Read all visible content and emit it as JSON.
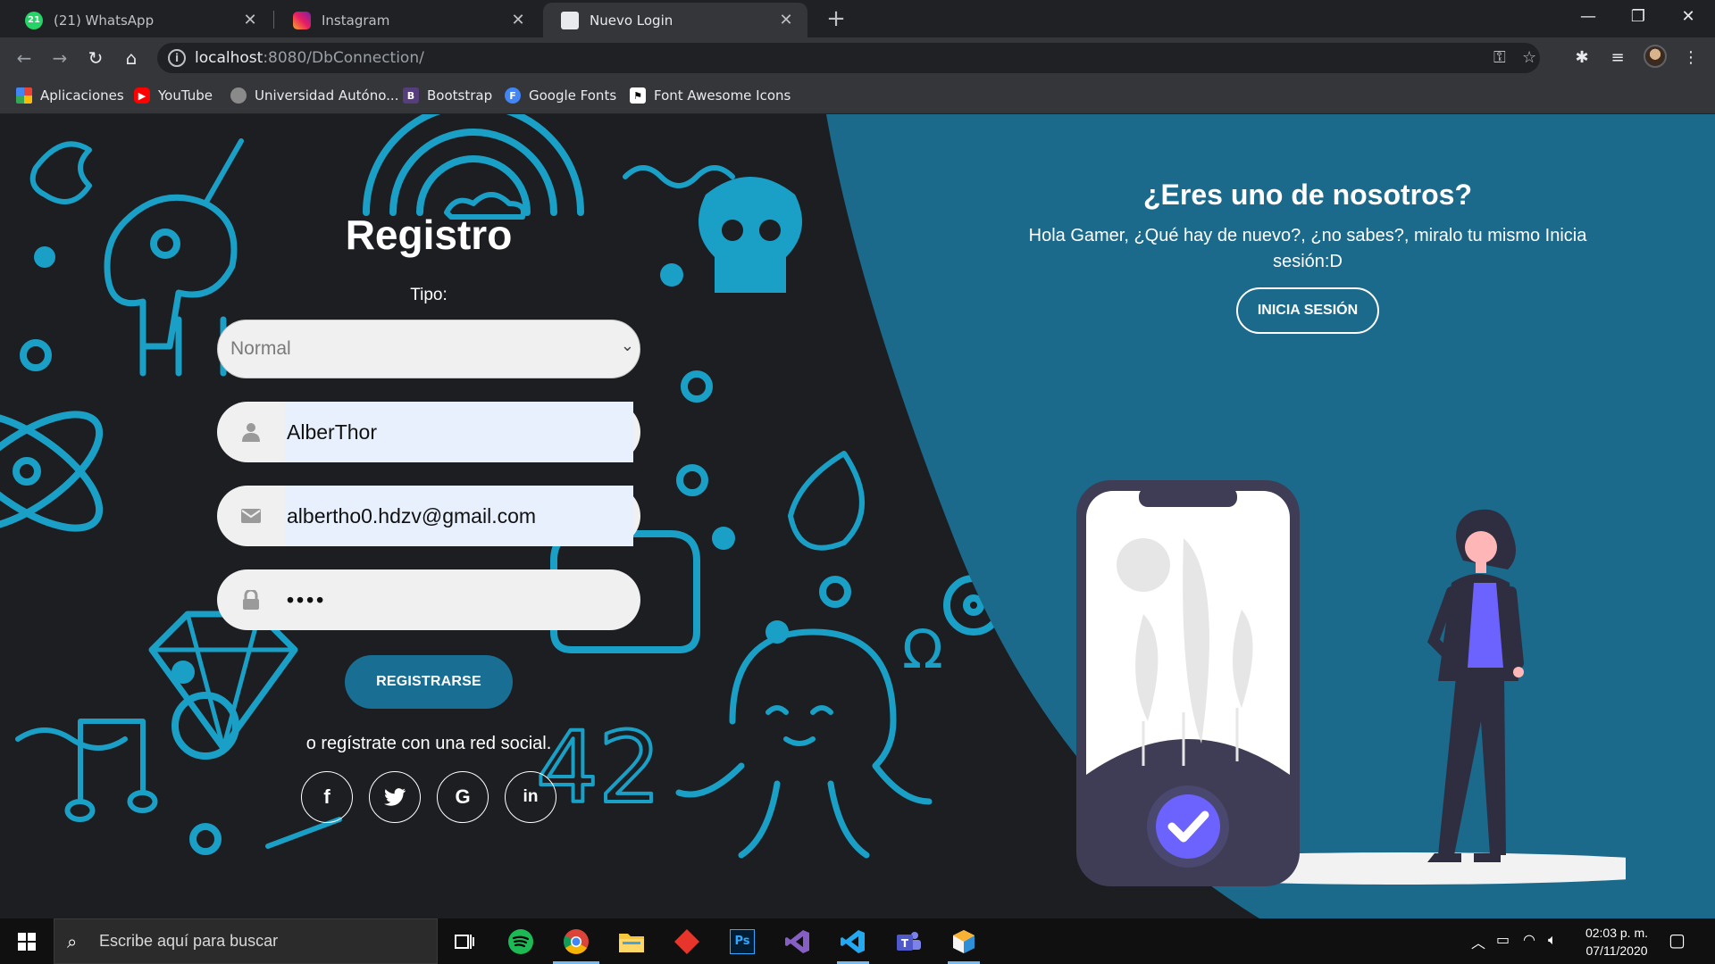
{
  "browser": {
    "tabs": [
      {
        "title": "(21) WhatsApp",
        "badge": "21",
        "active": false
      },
      {
        "title": "Instagram",
        "active": false
      },
      {
        "title": "Nuevo Login",
        "active": true
      }
    ],
    "url_host": "localhost",
    "url_rest": ":8080/DbConnection/",
    "bookmarks": [
      {
        "label": "Aplicaciones",
        "icon": "apps-grid-icon"
      },
      {
        "label": "YouTube",
        "icon": "youtube-icon"
      },
      {
        "label": "Universidad Autóno...",
        "icon": "university-seal-icon"
      },
      {
        "label": "Bootstrap",
        "icon": "bootstrap-icon",
        "glyph": "B"
      },
      {
        "label": "Google Fonts",
        "icon": "google-fonts-icon",
        "glyph": "F"
      },
      {
        "label": "Font Awesome Icons",
        "icon": "font-awesome-flag-icon"
      }
    ]
  },
  "signup": {
    "title": "Registro",
    "tipo_label": "Tipo:",
    "tipo_value": "Normal",
    "username": "AlberThor",
    "email": "albertho0.hdzv@gmail.com",
    "password_mask": "••••",
    "submit_label": "REGISTRARSE",
    "social_text": "o regístrate con una red social.",
    "social": [
      {
        "name": "facebook",
        "glyph": "f"
      },
      {
        "name": "twitter",
        "glyph": "t"
      },
      {
        "name": "google",
        "glyph": "G"
      },
      {
        "name": "linkedin",
        "glyph": "in"
      }
    ]
  },
  "cta": {
    "title": "¿Eres uno de nosotros?",
    "text": "Hola Gamer, ¿Qué hay de nuevo?, ¿no sabes?, miralo tu mismo Inicia sesión:D",
    "button_label": "INICIA SESIÓN"
  },
  "colors": {
    "panel_blue": "#1b6a8c",
    "doodle_blue": "#1aa0c6",
    "button_blue": "#186f93",
    "accent_purple": "#6c63ff",
    "dark_phone": "#3f3d56"
  },
  "taskbar": {
    "search_placeholder": "Escribe aquí para buscar",
    "time": "02:03 p. m.",
    "date": "07/11/2020",
    "apps": [
      "task-view-icon",
      "spotify-icon",
      "chrome-icon",
      "file-explorer-icon",
      "red-diamond-app-icon",
      "photoshop-icon",
      "visual-studio-icon",
      "vscode-icon",
      "teams-icon",
      "cube-app-icon"
    ]
  }
}
